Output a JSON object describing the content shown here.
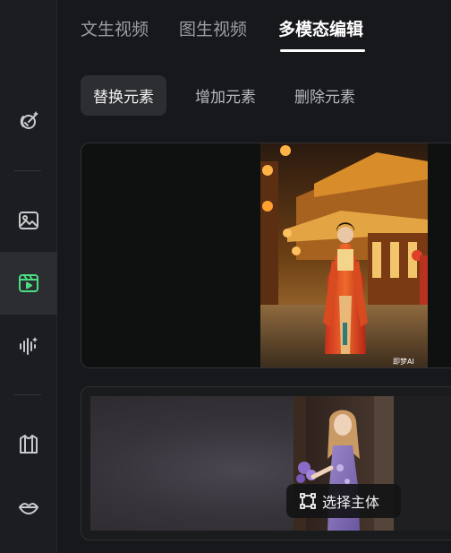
{
  "tabs": [
    {
      "label": "文生视频",
      "active": false
    },
    {
      "label": "图生视频",
      "active": false
    },
    {
      "label": "多模态编辑",
      "active": true
    }
  ],
  "subtabs": [
    {
      "label": "替换元素",
      "active": true
    },
    {
      "label": "增加元素",
      "active": false
    },
    {
      "label": "删除元素",
      "active": false
    }
  ],
  "sidebar": {
    "items": [
      {
        "icon": "magic-pen-icon"
      },
      {
        "icon": "image-icon"
      },
      {
        "icon": "video-icon",
        "active": true
      },
      {
        "icon": "audio-wave-icon"
      },
      {
        "icon": "shirt-icon"
      },
      {
        "icon": "lips-icon"
      }
    ],
    "accent": "#4ade80"
  },
  "cards": {
    "preview_watermark": "即梦AI",
    "select_subject_label": "选择主体"
  }
}
